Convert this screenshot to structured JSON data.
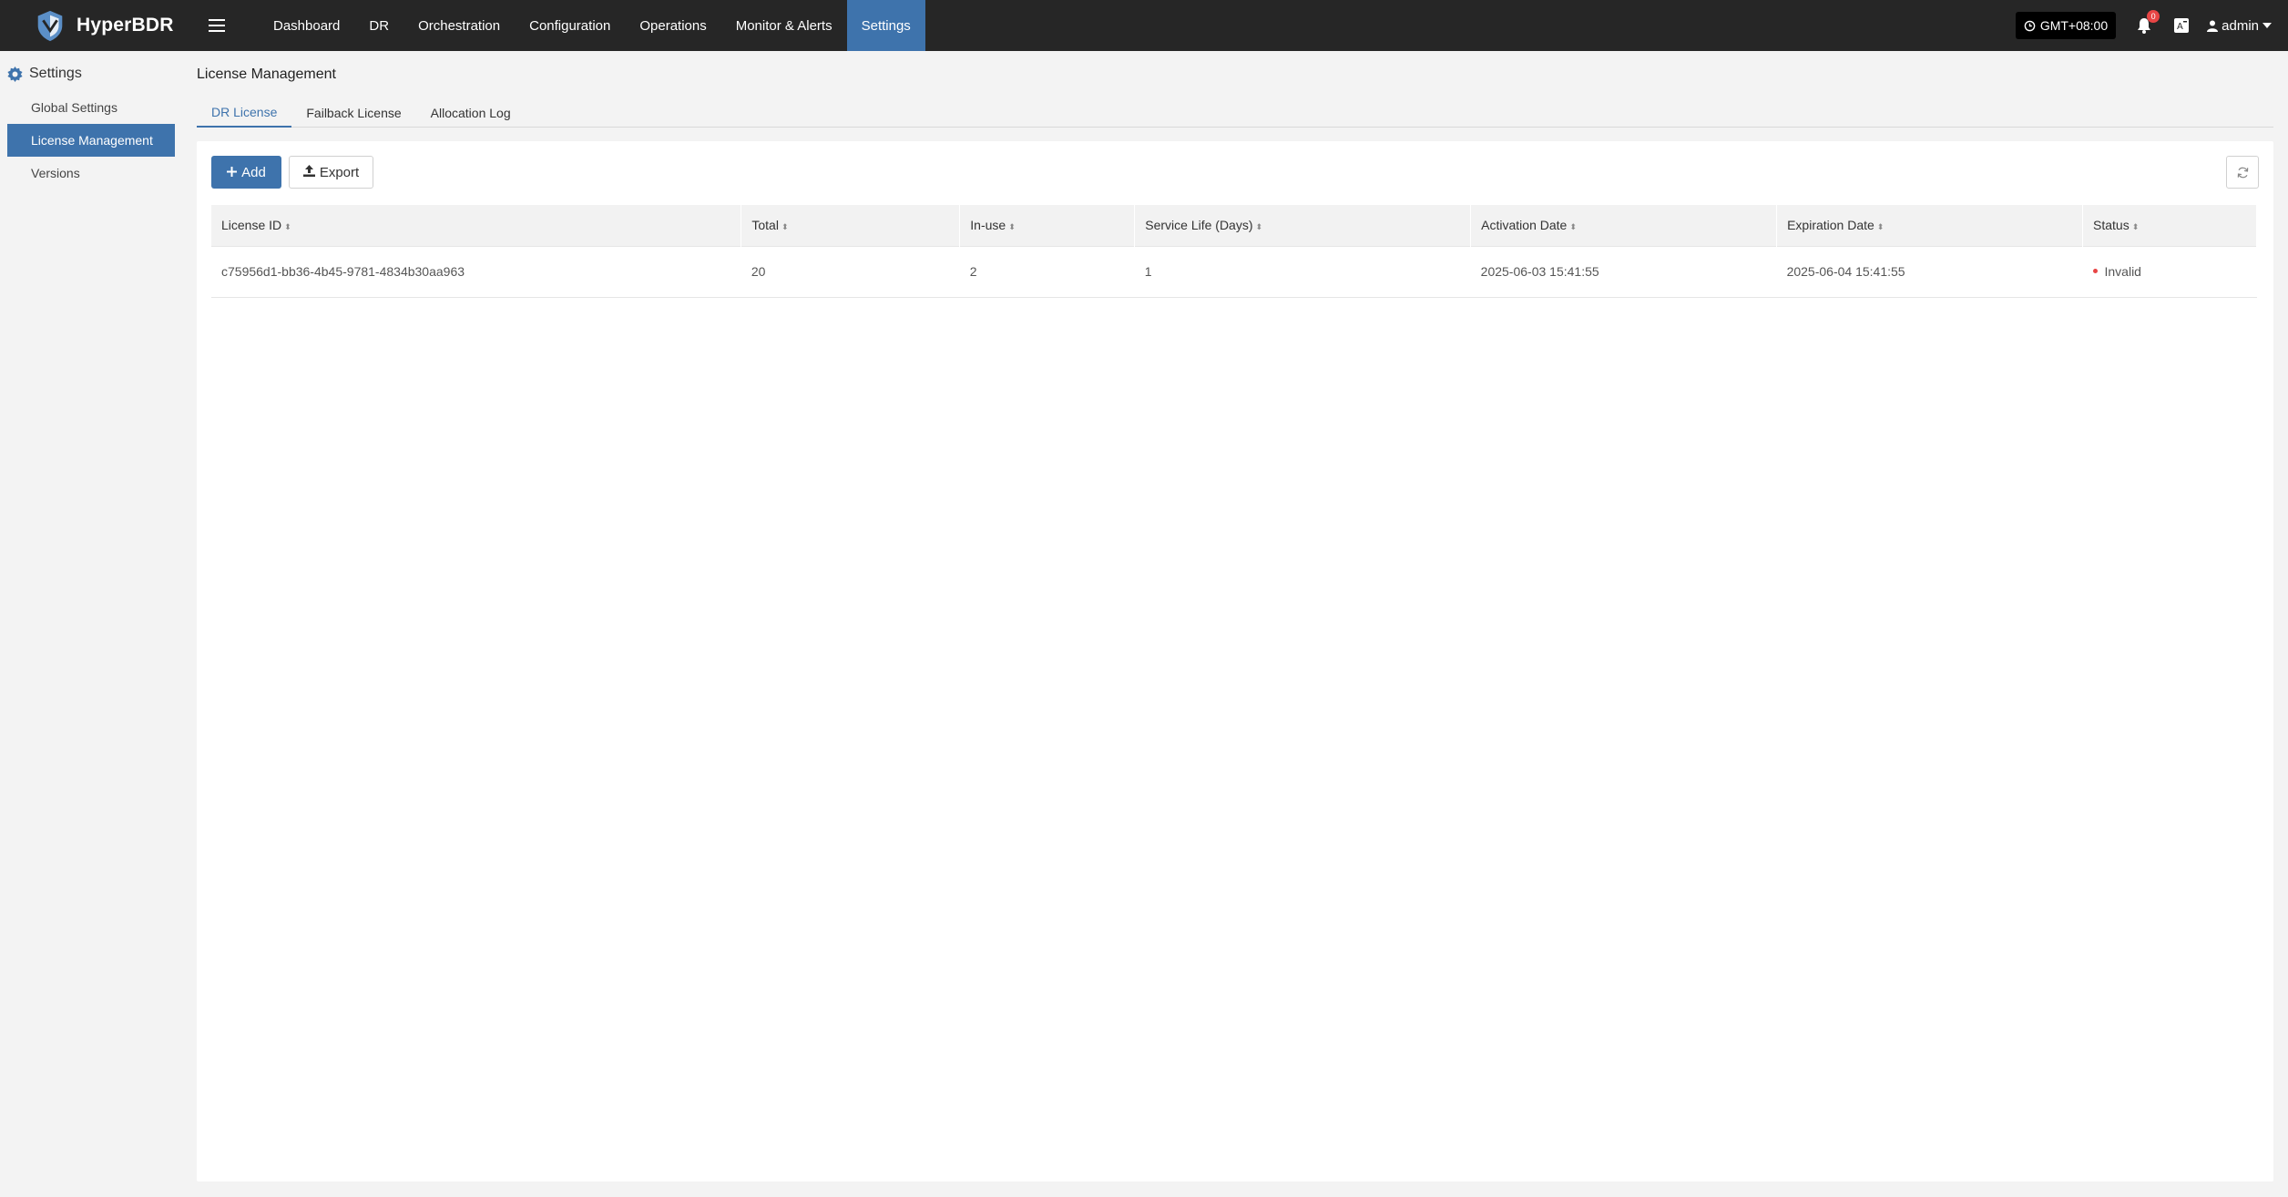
{
  "app": {
    "name": "HyperBDR"
  },
  "nav": {
    "items": [
      "Dashboard",
      "DR",
      "Orchestration",
      "Configuration",
      "Operations",
      "Monitor & Alerts",
      "Settings"
    ],
    "active": "Settings"
  },
  "topright": {
    "timezone": "GMT+08:00",
    "alert_count": "0",
    "user": "admin"
  },
  "sidebar": {
    "heading": "Settings",
    "items": [
      "Global Settings",
      "License Management",
      "Versions"
    ],
    "active": "License Management"
  },
  "page": {
    "title": "License Management",
    "tabs": [
      "DR License",
      "Failback License",
      "Allocation Log"
    ],
    "active_tab": "DR License"
  },
  "toolbar": {
    "add_label": "Add",
    "export_label": "Export"
  },
  "table": {
    "columns": [
      "License ID",
      "Total",
      "In-use",
      "Service Life (Days)",
      "Activation Date",
      "Expiration Date",
      "Status"
    ],
    "rows": [
      {
        "license_id": "c75956d1-bb36-4b45-9781-4834b30aa963",
        "total": "20",
        "in_use": "2",
        "service_life": "1",
        "activation_date": "2025-06-03 15:41:55",
        "expiration_date": "2025-06-04 15:41:55",
        "status": "Invalid",
        "status_color": "#e84545"
      }
    ]
  },
  "colors": {
    "topbar": "#262626",
    "accent": "#3e73ac",
    "danger": "#e84545"
  }
}
